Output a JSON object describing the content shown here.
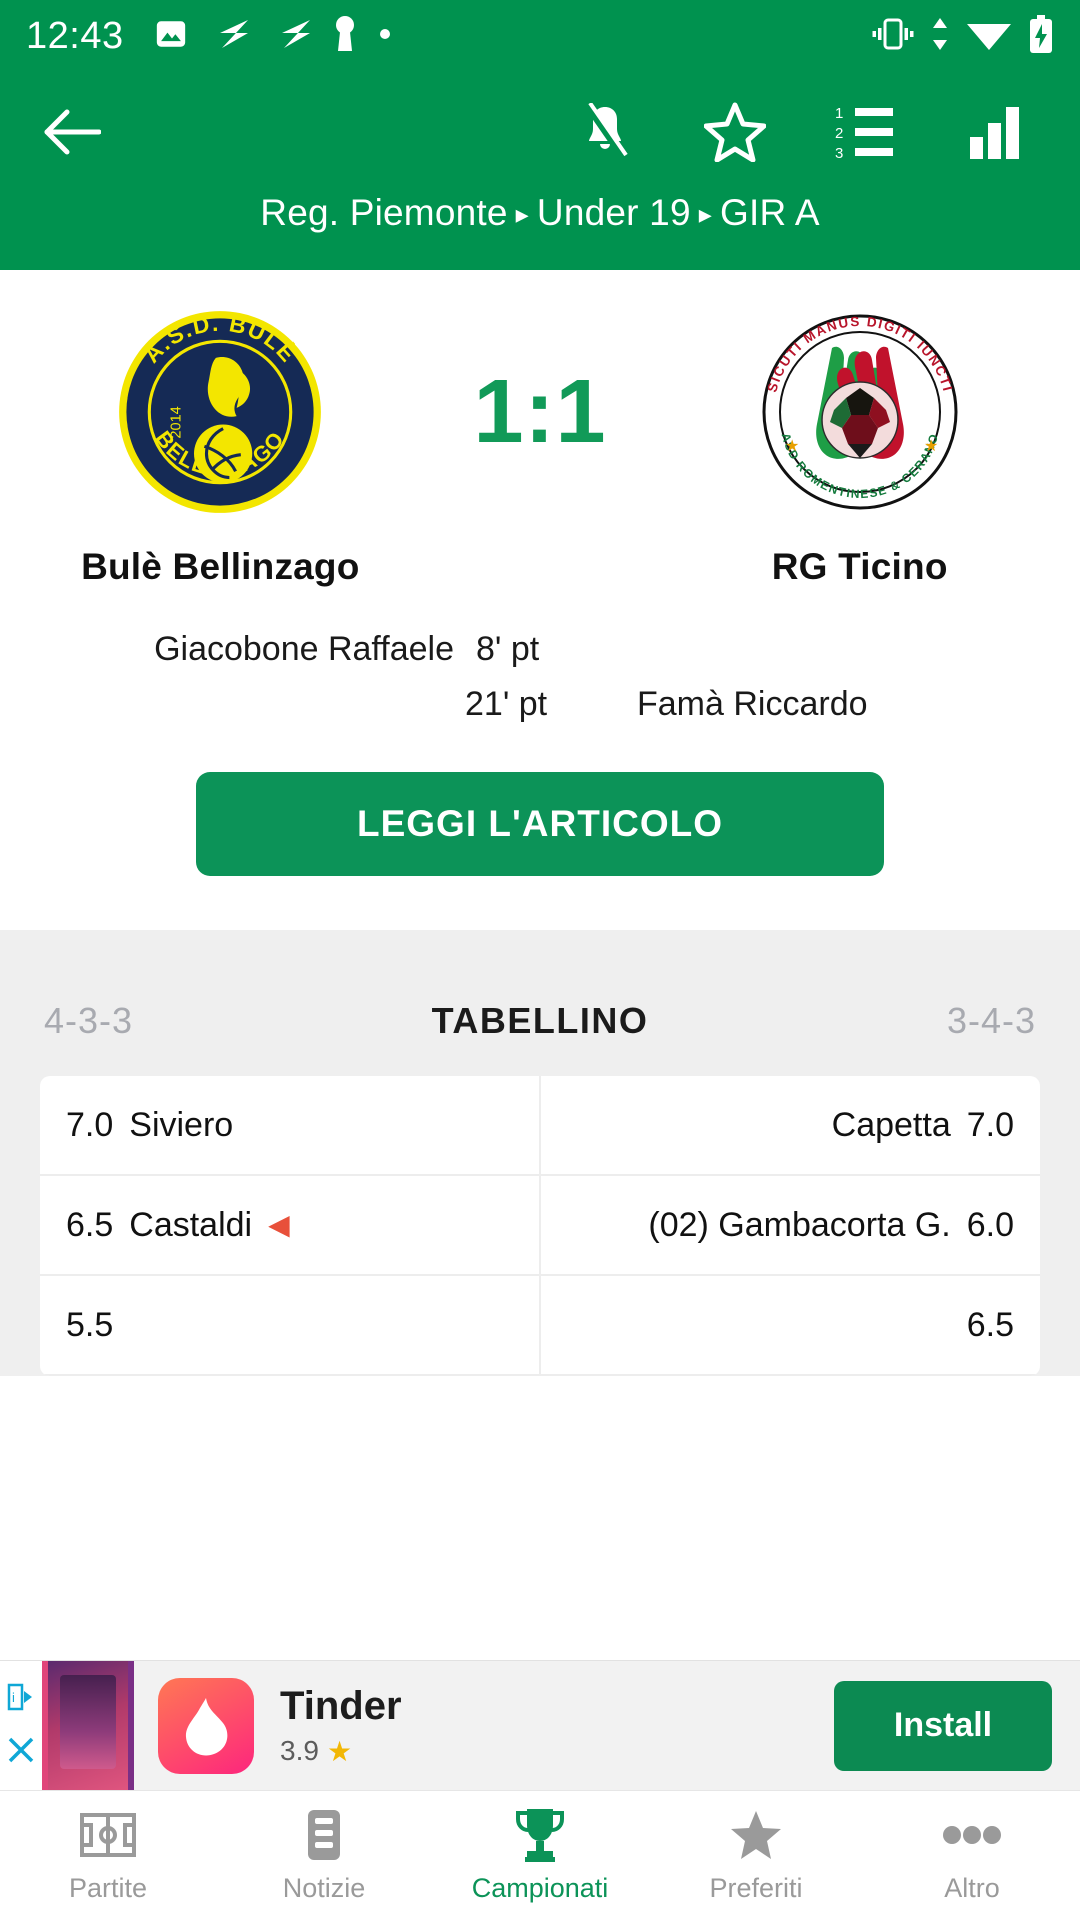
{
  "statusbar": {
    "time": "12:43",
    "left_icons": [
      "image-icon",
      "telegram-arrow-icon",
      "telegram-arrow-icon",
      "keyhole-icon",
      "dot-icon"
    ],
    "right_icons": [
      "vibrate-icon",
      "data-transfer-icon",
      "wifi-icon",
      "battery-charging-icon"
    ]
  },
  "appbar": {
    "back_label": "back-arrow",
    "actions": [
      "notifications-off-icon",
      "star-outline-icon",
      "ordered-list-icon",
      "stats-bars-icon"
    ],
    "breadcrumb": {
      "region": "Reg. Piemonte",
      "category": "Under 19",
      "group": "GIR A",
      "separator": "▸"
    }
  },
  "match": {
    "home": {
      "name": "Bulè Bellinzago",
      "crest": {
        "outer_ring": "#F3E600",
        "field": "#152A55",
        "accent": "#F3E600",
        "top_text": "A.S.D. BULÈ",
        "bottom_text": "BELLINZAGO",
        "year": "2014"
      }
    },
    "away": {
      "name": "RG Ticino",
      "crest": {
        "ring": "#ffffff",
        "top_text": "SICUTI MANUS DIGITI IUNCTI",
        "bottom_text": "ASD ROMENTINESE & CERANO",
        "green": "#179C48",
        "red": "#C1122C"
      }
    },
    "score": "1:1",
    "score_color": "#119A58",
    "scorers": [
      {
        "side": "home",
        "player": "Giacobone Raffaele",
        "minute": "8' pt"
      },
      {
        "side": "away",
        "player": "Famà Riccardo",
        "minute": "21' pt"
      }
    ],
    "cta_label": "LEGGI L'ARTICOLO"
  },
  "tabellino": {
    "title": "TABELLINO",
    "home_formation": "4-3-3",
    "away_formation": "3-4-3",
    "rows": [
      {
        "home": {
          "rating": "7.0",
          "player": "Siviero",
          "marker": ""
        },
        "away": {
          "rating": "7.0",
          "player": "Capetta",
          "marker": ""
        }
      },
      {
        "home": {
          "rating": "6.5",
          "player": "Castaldi",
          "marker": "◀"
        },
        "away": {
          "rating": "6.0",
          "player": "(02) Gambacorta G.",
          "marker": ""
        }
      },
      {
        "home": {
          "rating": "5.5",
          "player": "",
          "marker": ""
        },
        "away": {
          "rating": "6.5",
          "player": "",
          "marker": ""
        }
      }
    ]
  },
  "ad": {
    "title": "Tinder",
    "rating": "3.9",
    "star": "★",
    "install_label": "Install",
    "adchoices": "adchoices-icon",
    "close": "close-icon"
  },
  "bottomnav": {
    "items": [
      {
        "label": "Partite",
        "icon": "pitch-icon",
        "active": false
      },
      {
        "label": "Notizie",
        "icon": "news-icon",
        "active": false
      },
      {
        "label": "Campionati",
        "icon": "trophy-icon",
        "active": true
      },
      {
        "label": "Preferiti",
        "icon": "star-icon",
        "active": false
      },
      {
        "label": "Altro",
        "icon": "more-dots-icon",
        "active": false
      }
    ],
    "active_color": "#0C9358",
    "inactive_color": "#9A9A9A"
  }
}
